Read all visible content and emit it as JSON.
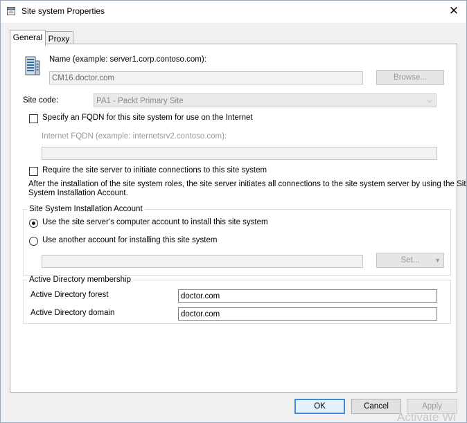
{
  "window": {
    "title": "Site system Properties"
  },
  "tabs": [
    {
      "label": "General"
    },
    {
      "label": "Proxy"
    }
  ],
  "general": {
    "name_label": "Name (example: server1.corp.contoso.com):",
    "name_value": "CM16.doctor.com",
    "browse_label": "Browse...",
    "site_code_label": "Site code:",
    "site_code_value": "PA1 - Packt Primary Site",
    "fqdn_checkbox_label": "Specify an FQDN for this site system for use on the Internet",
    "fqdn_checked": false,
    "internet_fqdn_label": "Internet FQDN (example: internetsrv2.contoso.com):",
    "internet_fqdn_value": "",
    "require_checkbox_label": "Require the site server to initiate connections to this site system",
    "require_checked": false,
    "info_line1": "After the  installation of the site system roles, the site server initiates all connections to the site system server by using the Site",
    "info_line2": "System Installation Account.",
    "install_account": {
      "group_label": "Site System Installation Account",
      "option_computer": "Use the site server's computer account to install this site system",
      "option_other": "Use another account for installing this site system",
      "selected": "computer",
      "account_value": "",
      "set_label": "Set..."
    },
    "ad_membership": {
      "group_label": "Active Directory membership",
      "forest_label": "Active Directory forest",
      "forest_value": "doctor.com",
      "domain_label": "Active Directory domain",
      "domain_value": "doctor.com"
    }
  },
  "footer": {
    "ok_label": "OK",
    "cancel_label": "Cancel",
    "apply_label": "Apply"
  },
  "watermark": "Activate Wi",
  "icons": {
    "app": "properties-icon",
    "close": "close-icon",
    "server": "server-icon",
    "dropdown": "chevron-down-icon"
  },
  "colors": {
    "default_button_border": "#3c8ddb",
    "disabled_text": "#9a9a9a"
  }
}
